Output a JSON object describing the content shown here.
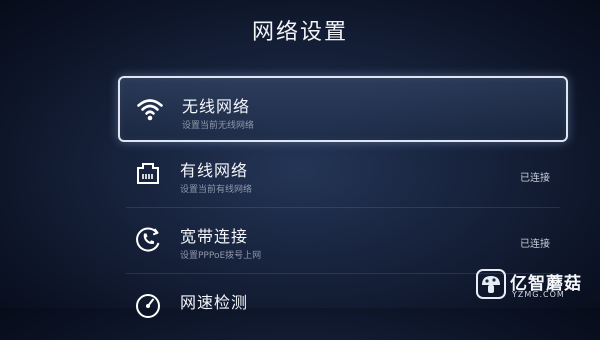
{
  "page": {
    "title": "网络设置"
  },
  "menu": {
    "items": [
      {
        "label": "无线网络",
        "subtitle": "设置当前无线网络",
        "status": "",
        "icon": "wifi-icon",
        "selected": true
      },
      {
        "label": "有线网络",
        "subtitle": "设置当前有线网络",
        "status": "已连接",
        "icon": "ethernet-icon",
        "selected": false
      },
      {
        "label": "宽带连接",
        "subtitle": "设置PPPoE拨号上网",
        "status": "已连接",
        "icon": "phone-dial-icon",
        "selected": false
      },
      {
        "label": "网速检测",
        "subtitle": "",
        "status": "",
        "icon": "speedometer-icon",
        "selected": false
      }
    ]
  },
  "watermark": {
    "brand": "亿智蘑菇",
    "url": "YZMG.COM",
    "icon": "mushroom-logo-icon"
  },
  "colors": {
    "background_center": "#243556",
    "background_edge": "#070c19",
    "highlight_border": "#dfe6f2",
    "subtitle_text": "#8d97aa"
  }
}
